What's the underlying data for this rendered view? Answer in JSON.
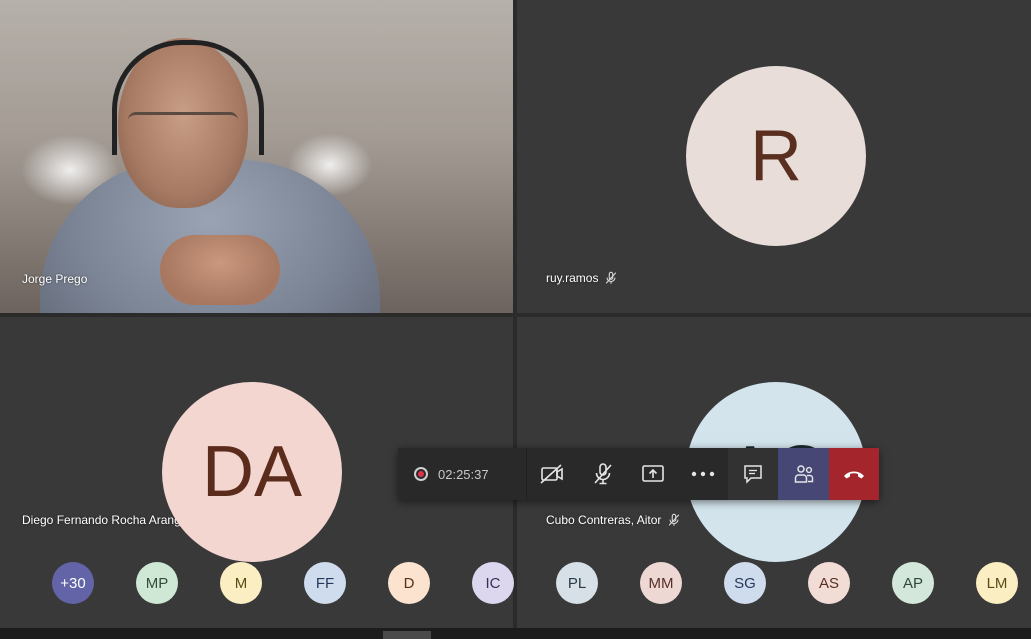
{
  "participants": {
    "tile1": {
      "name": "Jorge Prego"
    },
    "tile2": {
      "name": "ruy.ramos",
      "initials": "R"
    },
    "tile3": {
      "name": "Diego Fernando Rocha Arango",
      "initials": "DA"
    },
    "tile4": {
      "name": "Cubo Contreras, Aitor",
      "initials": "AC"
    }
  },
  "call_bar": {
    "timer": "02:25:37",
    "recording_color": "#e0314a",
    "hangup_color": "#a4262c",
    "people_active_color": "#464775"
  },
  "strip": [
    {
      "label": "+30",
      "bg": "#6264a7",
      "fg": "#ffffff"
    },
    {
      "label": "MP",
      "bg": "#cfe8d6",
      "fg": "#2f4d37"
    },
    {
      "label": "M",
      "bg": "#fbeec2",
      "fg": "#5a4a15"
    },
    {
      "label": "FF",
      "bg": "#cfdcee",
      "fg": "#27385a"
    },
    {
      "label": "D",
      "bg": "#fbe3cf",
      "fg": "#5a3315"
    },
    {
      "label": "IC",
      "bg": "#dcd6ee",
      "fg": "#3a2f5a"
    },
    {
      "label": "PL",
      "bg": "#d6e0e6",
      "fg": "#2a3a45"
    },
    {
      "label": "MM",
      "bg": "#eed8d4",
      "fg": "#5a2f2a"
    },
    {
      "label": "SG",
      "bg": "#cfdcee",
      "fg": "#27385a"
    },
    {
      "label": "AS",
      "bg": "#f2ddd6",
      "fg": "#5a3020"
    },
    {
      "label": "AP",
      "bg": "#d3e7da",
      "fg": "#2c4a37"
    },
    {
      "label": "LM",
      "bg": "#fbeec2",
      "fg": "#5a4a15"
    }
  ]
}
